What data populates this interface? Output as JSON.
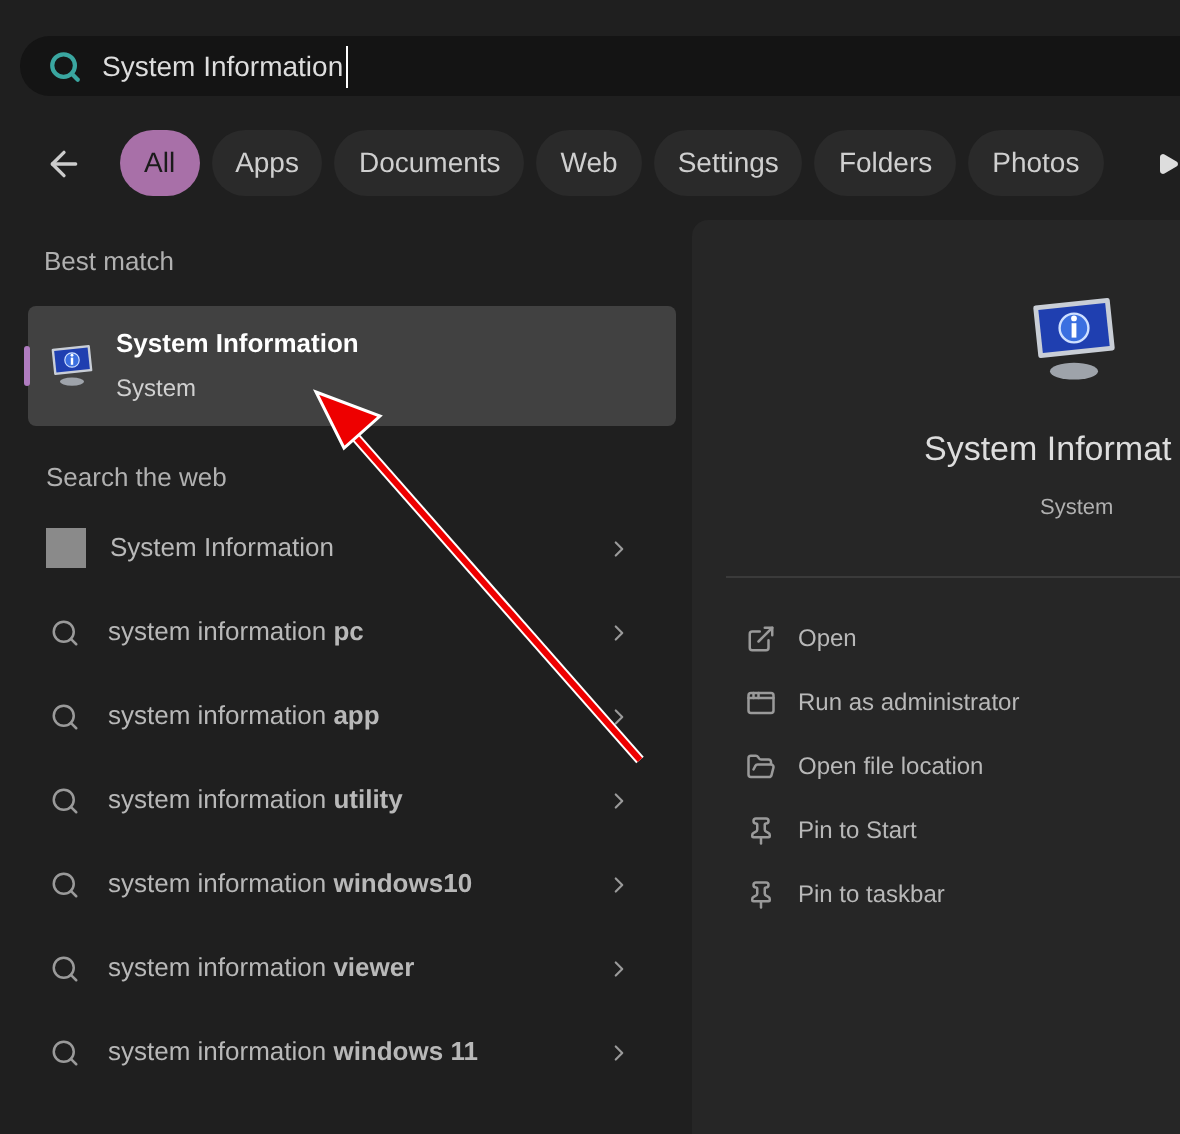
{
  "search": {
    "value": "System Information"
  },
  "filters": [
    {
      "label": "All",
      "selected": true
    },
    {
      "label": "Apps",
      "selected": false
    },
    {
      "label": "Documents",
      "selected": false
    },
    {
      "label": "Web",
      "selected": false
    },
    {
      "label": "Settings",
      "selected": false
    },
    {
      "label": "Folders",
      "selected": false
    },
    {
      "label": "Photos",
      "selected": false
    }
  ],
  "best_match": {
    "heading": "Best match",
    "title": "System Information",
    "subtitle": "System",
    "selected": true
  },
  "web": {
    "heading": "Search the web",
    "items": [
      {
        "kind": "page",
        "text": "System Information"
      },
      {
        "kind": "search",
        "text": "system information **pc**"
      },
      {
        "kind": "search",
        "text": "system information **app**"
      },
      {
        "kind": "search",
        "text": "system information **utility**"
      },
      {
        "kind": "search",
        "text": "system information **windows10**"
      },
      {
        "kind": "search",
        "text": "system information **viewer**"
      },
      {
        "kind": "search",
        "text": "system information **windows 11**"
      }
    ]
  },
  "preview": {
    "title": "System Informat",
    "subtitle": "System",
    "actions": [
      {
        "kind": "open",
        "label": "Open"
      },
      {
        "kind": "admin",
        "label": "Run as administrator"
      },
      {
        "kind": "folder",
        "label": "Open file location"
      },
      {
        "kind": "pin",
        "label": "Pin to Start"
      },
      {
        "kind": "pin",
        "label": "Pin to taskbar"
      }
    ]
  }
}
